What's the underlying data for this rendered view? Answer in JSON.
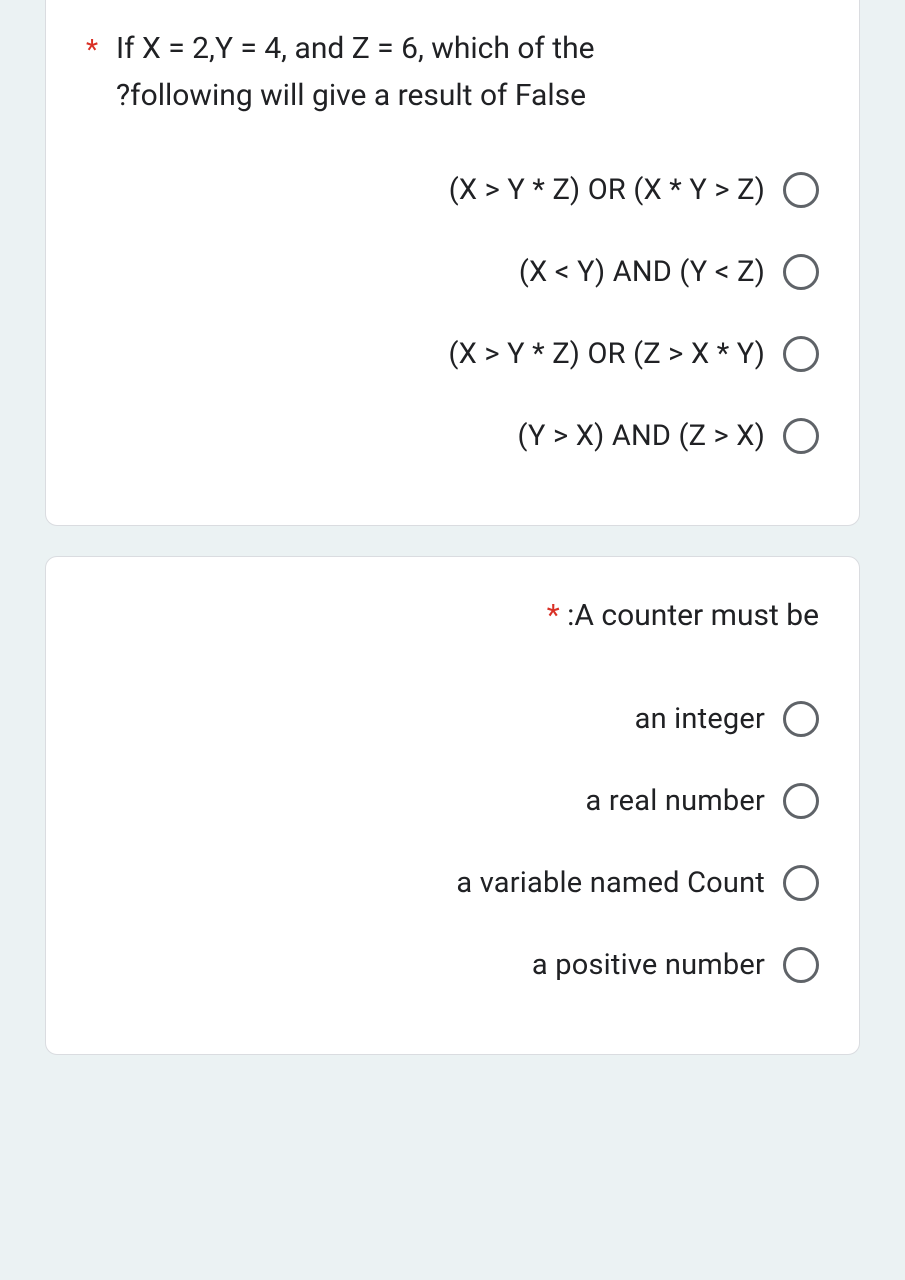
{
  "question1": {
    "required_marker": "*",
    "line1": "If X = 2,Y = 4, and Z = 6, which of the",
    "line2": "?following will give a result of False",
    "options": [
      "(X > Y * Z) OR (X * Y > Z)",
      "(X < Y) AND (Y < Z)",
      "(X > Y * Z) OR (Z > X * Y)",
      "(Y > X) AND (Z > X)"
    ]
  },
  "question2": {
    "required_marker": "*",
    "text": ":A counter must be",
    "options": [
      "an integer",
      "a real number",
      "a variable named Count",
      "a positive number"
    ]
  }
}
